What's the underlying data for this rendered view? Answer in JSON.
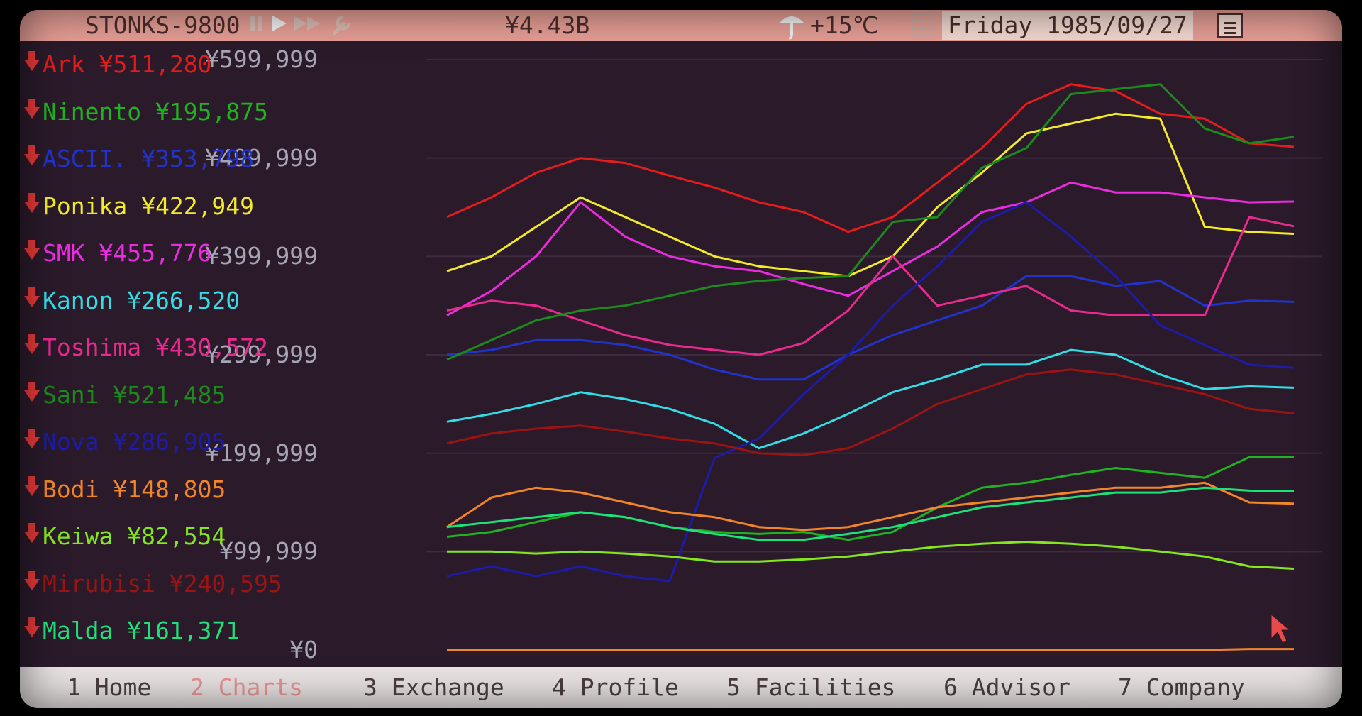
{
  "topbar": {
    "app_title": "STONKS-9800",
    "pause_icon": "pause-icon",
    "play_icon": "play-icon",
    "fast_forward_icon": "fast-forward-icon",
    "wrench_icon": "wrench-icon",
    "money": "¥4.43B",
    "weather_icon": "umbrella-icon",
    "temperature": "+15℃",
    "calendar_icon": "calendar-icon",
    "date": "Friday 1985/09/27",
    "menu_icon": "menu-icon"
  },
  "tickers": [
    {
      "name": "Ark",
      "price": "¥511,280",
      "color": "#e41c1c"
    },
    {
      "name": "Ninento",
      "price": "¥195,875",
      "color": "#1fb31f"
    },
    {
      "name": "ASCII.",
      "price": "¥353,798",
      "color": "#2233cc"
    },
    {
      "name": "Ponika",
      "price": "¥422,949",
      "color": "#f2ea2a"
    },
    {
      "name": "SMK",
      "price": "¥455,776",
      "color": "#ea2ce0"
    },
    {
      "name": "Kanon",
      "price": "¥266,520",
      "color": "#32dde6"
    },
    {
      "name": "Toshima",
      "price": "¥430,572",
      "color": "#e82a8e"
    },
    {
      "name": "Sani",
      "price": "¥521,485",
      "color": "#1c8a1c"
    },
    {
      "name": "Nova",
      "price": "¥286,905",
      "color": "#1c1ca8"
    },
    {
      "name": "Bodi",
      "price": "¥148,805",
      "color": "#f2852a"
    },
    {
      "name": "Keiwa",
      "price": "¥82,554",
      "color": "#84e61c"
    },
    {
      "name": "Mirubisi",
      "price": "¥240,595",
      "color": "#9a1414"
    },
    {
      "name": "Malda",
      "price": "¥161,371",
      "color": "#1ce27c"
    }
  ],
  "chart_data": {
    "type": "line",
    "y_tick_labels": [
      "¥599,999",
      "¥499,999",
      "¥399,999",
      "¥299,999",
      "¥199,999",
      "¥99,999",
      "¥0"
    ],
    "ylim": [
      0,
      600000
    ],
    "grid": true,
    "series": [
      {
        "name": "Ark",
        "color": "#e41c1c",
        "values": [
          440000,
          460000,
          485000,
          500000,
          495000,
          482000,
          470000,
          455000,
          445000,
          425000,
          440000,
          475000,
          510000,
          555000,
          575000,
          568000,
          545000,
          540000,
          515000,
          511280
        ]
      },
      {
        "name": "Ninento",
        "color": "#1fb31f",
        "values": [
          115000,
          120000,
          130000,
          140000,
          135000,
          125000,
          120000,
          118000,
          120000,
          112000,
          120000,
          145000,
          165000,
          170000,
          178000,
          185000,
          180000,
          175000,
          196000,
          195875
        ]
      },
      {
        "name": "ASCII.",
        "color": "#2233cc",
        "values": [
          300000,
          305000,
          315000,
          315000,
          310000,
          300000,
          285000,
          275000,
          275000,
          300000,
          320000,
          335000,
          350000,
          380000,
          380000,
          370000,
          375000,
          350000,
          355000,
          353798
        ]
      },
      {
        "name": "Ponika",
        "color": "#f2ea2a",
        "values": [
          385000,
          400000,
          430000,
          460000,
          440000,
          420000,
          400000,
          390000,
          385000,
          380000,
          400000,
          450000,
          485000,
          525000,
          535000,
          545000,
          540000,
          430000,
          425000,
          422949
        ]
      },
      {
        "name": "SMK",
        "color": "#ea2ce0",
        "values": [
          340000,
          365000,
          400000,
          455000,
          420000,
          400000,
          390000,
          385000,
          372000,
          360000,
          385000,
          410000,
          445000,
          455000,
          475000,
          465000,
          465000,
          460000,
          455000,
          455776
        ]
      },
      {
        "name": "Kanon",
        "color": "#32dde6",
        "values": [
          232000,
          240000,
          250000,
          262000,
          255000,
          245000,
          230000,
          205000,
          220000,
          240000,
          262000,
          275000,
          290000,
          290000,
          305000,
          300000,
          280000,
          265000,
          268000,
          266520
        ]
      },
      {
        "name": "Toshima",
        "color": "#e82a8e",
        "values": [
          345000,
          355000,
          350000,
          335000,
          320000,
          310000,
          305000,
          300000,
          312000,
          345000,
          400000,
          350000,
          360000,
          370000,
          345000,
          340000,
          340000,
          340000,
          440000,
          430572
        ]
      },
      {
        "name": "Sani",
        "color": "#1c8a1c",
        "values": [
          295000,
          315000,
          335000,
          345000,
          350000,
          360000,
          370000,
          375000,
          378000,
          380000,
          435000,
          440000,
          490000,
          510000,
          565000,
          570000,
          575000,
          530000,
          515000,
          521485
        ]
      },
      {
        "name": "Nova",
        "color": "#1c1ca8",
        "values": [
          75000,
          85000,
          75000,
          85000,
          75000,
          70000,
          195000,
          215000,
          260000,
          300000,
          350000,
          390000,
          435000,
          455000,
          420000,
          380000,
          330000,
          310000,
          290000,
          286905
        ]
      },
      {
        "name": "Bodi",
        "color": "#f2852a",
        "values": [
          125000,
          155000,
          165000,
          160000,
          150000,
          140000,
          135000,
          125000,
          122000,
          125000,
          135000,
          145000,
          150000,
          155000,
          160000,
          165000,
          165000,
          170000,
          150000,
          148805
        ]
      },
      {
        "name": "Keiwa",
        "color": "#84e61c",
        "values": [
          100000,
          100000,
          98000,
          100000,
          98000,
          95000,
          90000,
          90000,
          92000,
          95000,
          100000,
          105000,
          108000,
          110000,
          108000,
          105000,
          100000,
          95000,
          85000,
          82554
        ]
      },
      {
        "name": "Mirubisi",
        "color": "#9a1414",
        "values": [
          210000,
          220000,
          225000,
          228000,
          222000,
          215000,
          210000,
          200000,
          198000,
          205000,
          225000,
          250000,
          265000,
          280000,
          285000,
          280000,
          270000,
          260000,
          245000,
          240595
        ]
      },
      {
        "name": "Malda",
        "color": "#1ce27c",
        "values": [
          125000,
          130000,
          135000,
          140000,
          135000,
          125000,
          118000,
          112000,
          112000,
          118000,
          125000,
          135000,
          145000,
          150000,
          155000,
          160000,
          160000,
          165000,
          162000,
          161371
        ]
      },
      {
        "name": "",
        "color": "#f2852a",
        "values": [
          0,
          0,
          0,
          0,
          0,
          0,
          0,
          0,
          0,
          0,
          0,
          0,
          0,
          0,
          0,
          0,
          0,
          0,
          1000,
          1000
        ]
      }
    ]
  },
  "bottombar": {
    "tabs": [
      {
        "key": "1",
        "label": "Home"
      },
      {
        "key": "2",
        "label": "Charts"
      },
      {
        "key": "3",
        "label": "Exchange"
      },
      {
        "key": "4",
        "label": "Profile"
      },
      {
        "key": "5",
        "label": "Facilities"
      },
      {
        "key": "6",
        "label": "Advisor"
      },
      {
        "key": "7",
        "label": "Company"
      }
    ],
    "active_tab": "2"
  },
  "cursor_icon": "mouse-cursor-icon"
}
